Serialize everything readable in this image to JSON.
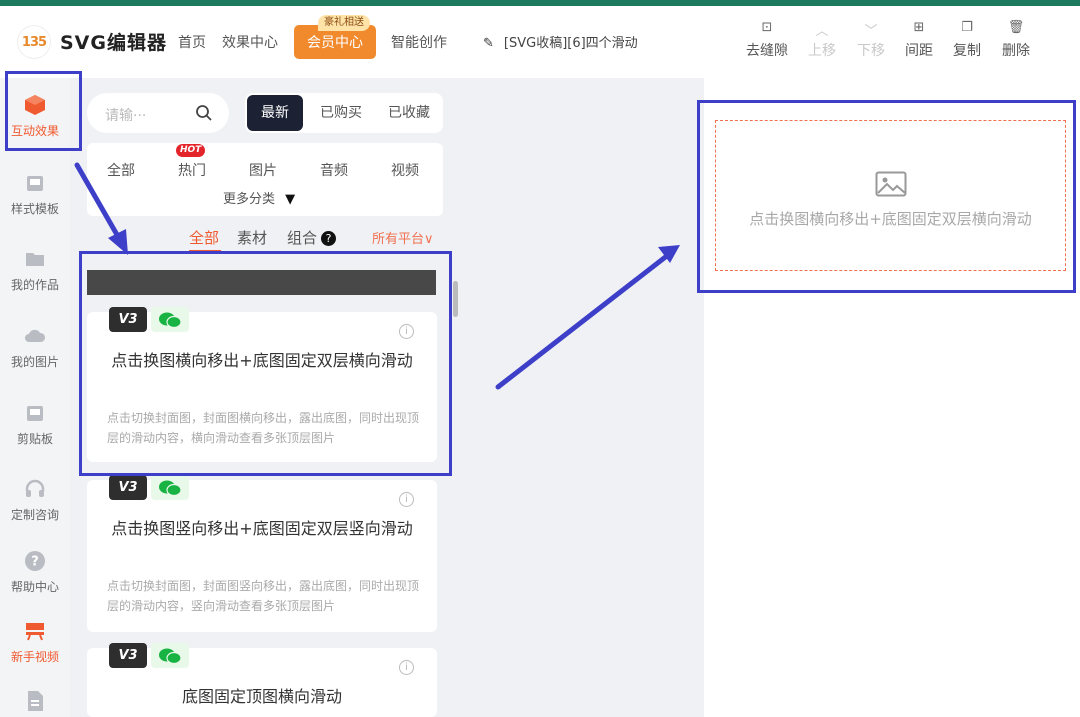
{
  "brand": {
    "logo_text": "135",
    "name": "SVG编辑器"
  },
  "nav": {
    "home": "首页",
    "effects": "效果中心",
    "vip": "会员中心",
    "vip_badge": "豪礼相送",
    "ai": "智能创作"
  },
  "document": {
    "title": "[SVG收稿][6]四个滑动"
  },
  "toolbar": {
    "remove_gap": "去缝隙",
    "move_up": "上移",
    "move_down": "下移",
    "spacing": "间距",
    "copy": "复制",
    "delete": "删除"
  },
  "sidebar": {
    "items": [
      {
        "label": "互动效果",
        "icon": "cube-icon",
        "active": true
      },
      {
        "label": "样式模板",
        "icon": "template-icon"
      },
      {
        "label": "我的作品",
        "icon": "folder-icon"
      },
      {
        "label": "我的图片",
        "icon": "cloud-icon"
      },
      {
        "label": "剪贴板",
        "icon": "clipboard-icon"
      },
      {
        "label": "定制咨询",
        "icon": "headset-icon"
      },
      {
        "label": "帮助中心",
        "icon": "help-icon"
      },
      {
        "label": "新手视频",
        "icon": "video-icon"
      },
      {
        "label": "",
        "icon": "document-icon"
      }
    ]
  },
  "search": {
    "placeholder": "请输···"
  },
  "sort_tabs": [
    "最新",
    "已购买",
    "已收藏"
  ],
  "categories": [
    "全部",
    "热门",
    "图片",
    "音频",
    "视频"
  ],
  "hot_badge": "HOT",
  "more_categories": "更多分类",
  "filters": {
    "all": "全部",
    "material": "素材",
    "combo": "组合",
    "help": "?",
    "platform": "所有平台"
  },
  "cards": [
    {
      "tag_version": "V3",
      "title": "点击换图横向移出+底图固定双层横向滑动",
      "desc": "点击切换封面图，封面图横向移出，露出底图，同时出现顶层的滑动内容，横向滑动查看多张顶层图片"
    },
    {
      "tag_version": "V3",
      "title": "点击换图竖向移出+底图固定双层竖向滑动",
      "desc": "点击切换封面图，封面图竖向移出，露出底图，同时出现顶层的滑动内容，竖向滑动查看多张顶层图片"
    },
    {
      "tag_version": "V3",
      "title": "底图固定顶图横向滑动",
      "desc": ""
    }
  ],
  "canvas": {
    "placeholder_text": "点击换图横向移出+底图固定双层横向滑动"
  },
  "colors": {
    "accent": "#f05a30",
    "vip": "#f08a2c",
    "annotation": "#3d3fc9",
    "topline": "#1e7a5e"
  }
}
